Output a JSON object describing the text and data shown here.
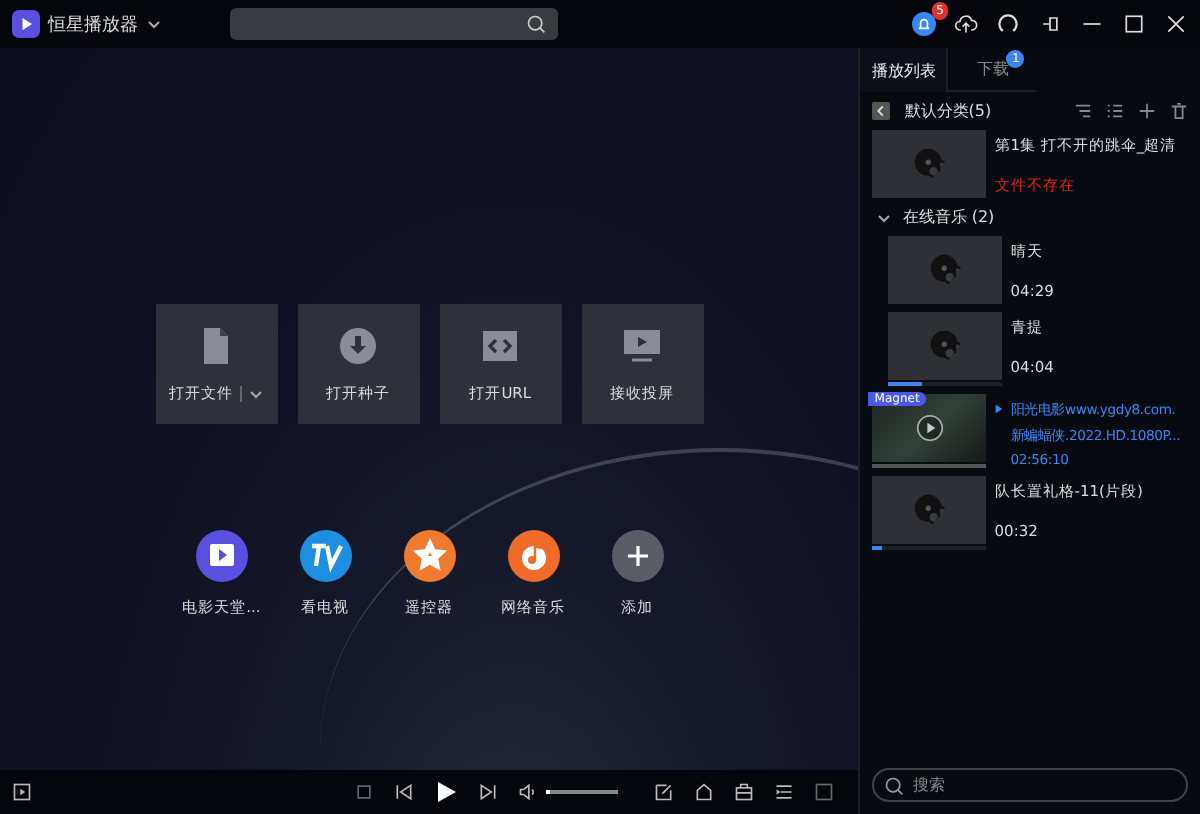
{
  "app": {
    "title": "恒星播放器",
    "notifications": "5"
  },
  "tabs": [
    {
      "label": "播放列表",
      "selected": true
    },
    {
      "label": "下载",
      "selected": false,
      "badge": "1"
    }
  ],
  "playlist": {
    "category": "默认分类(5)",
    "items": [
      {
        "kind": "media",
        "title": "第1集 打不开的跳伞_超清",
        "status": "文件不存在"
      },
      {
        "kind": "group",
        "title": "在线音乐 (2)",
        "expanded": true,
        "children": [
          {
            "title": "晴天",
            "duration": "04:29"
          },
          {
            "title": "青提",
            "duration": "04:04",
            "level": 0.3
          }
        ]
      },
      {
        "kind": "magnet",
        "badge": "Magnet",
        "lines": [
          "阳光电影www.ygdy8.com.",
          "新蝙蝠侠.2022.HD.1080P..."
        ],
        "duration": "02:56:10",
        "playing": true
      },
      {
        "kind": "media",
        "title": "队长置礼格-11(片段)",
        "duration": "00:32",
        "level": 0.08
      }
    ]
  },
  "search": {
    "placeholder": "搜索"
  },
  "actions": [
    {
      "label": "打开文件",
      "dropdown": true
    },
    {
      "label": "打开种子",
      "dropdown": false
    },
    {
      "label": "打开URL",
      "dropdown": false
    },
    {
      "label": "接收投屏",
      "dropdown": false
    }
  ],
  "apps": [
    {
      "label": "电影天堂...",
      "color": "#5b4fe0"
    },
    {
      "label": "看电视",
      "color": "#1e8fe0"
    },
    {
      "label": "遥控器",
      "color": "#f07a30"
    },
    {
      "label": "网络音乐",
      "color": "#f06a2a"
    },
    {
      "label": "添加",
      "color": "#5a5d66"
    }
  ],
  "volume": {
    "level": 0.05
  }
}
